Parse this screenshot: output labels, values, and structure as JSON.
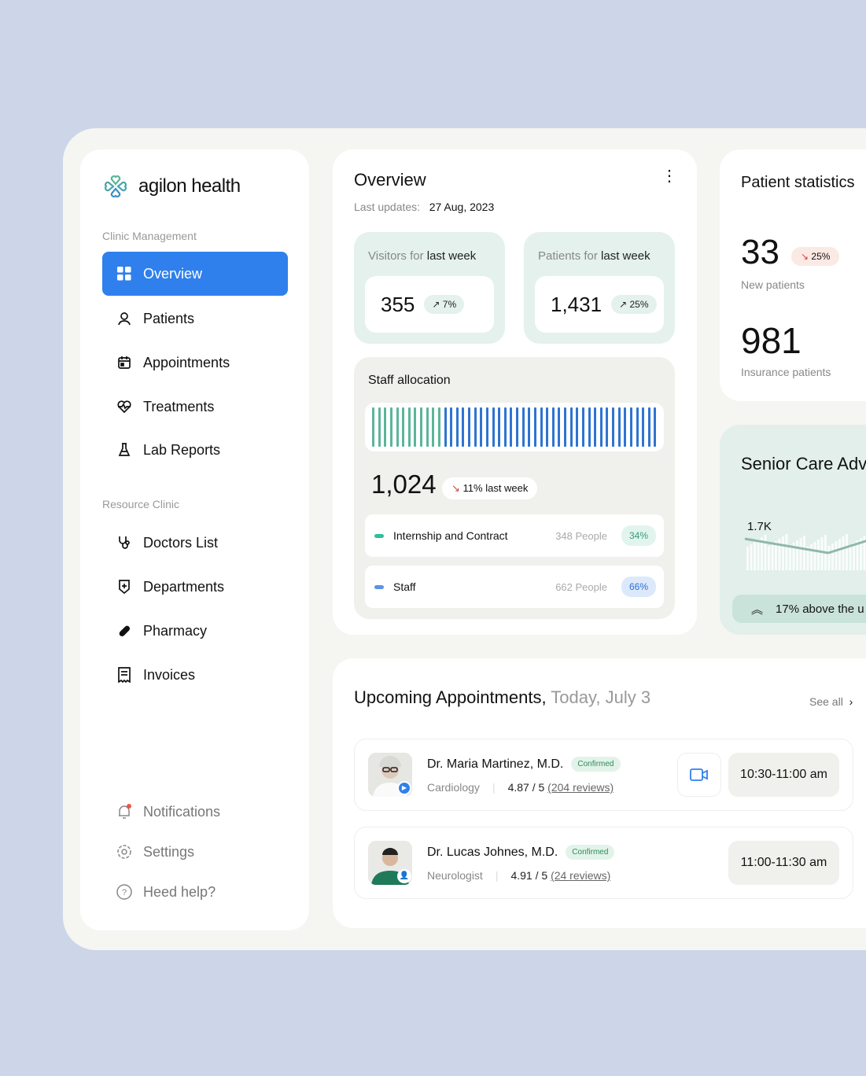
{
  "brand": {
    "name": "agilon health"
  },
  "sidebar": {
    "section1": "Clinic Management",
    "items": [
      {
        "label": "Overview",
        "icon": "grid-icon"
      },
      {
        "label": "Patients",
        "icon": "user-icon"
      },
      {
        "label": "Appointments",
        "icon": "calendar-icon"
      },
      {
        "label": "Treatments",
        "icon": "heart-pulse-icon"
      },
      {
        "label": "Lab Reports",
        "icon": "flask-icon"
      }
    ],
    "section2": "Resource Clinic",
    "items2": [
      {
        "label": "Doctors List",
        "icon": "stethoscope-icon"
      },
      {
        "label": "Departments",
        "icon": "shield-plus-icon"
      },
      {
        "label": "Pharmacy",
        "icon": "pill-icon"
      },
      {
        "label": "Invoices",
        "icon": "receipt-icon"
      }
    ],
    "bottom": [
      {
        "label": "Notifications",
        "icon": "bell-icon"
      },
      {
        "label": "Settings",
        "icon": "gear-icon"
      },
      {
        "label": "Heed help?",
        "icon": "help-icon"
      }
    ]
  },
  "overview": {
    "title": "Overview",
    "updates_label": "Last updates:",
    "updates_date": "27 Aug, 2023",
    "visitors": {
      "label_pre": "Visitors for",
      "label_bold": "last week",
      "value": "355",
      "change": "7%"
    },
    "patients": {
      "label_pre": "Patients for",
      "label_bold": "last week",
      "value": "1,431",
      "change": "25%"
    },
    "staff": {
      "title": "Staff allocation",
      "total": "1,024",
      "change": "11% last week",
      "rows": [
        {
          "label": "Internship and Contract",
          "people": "348 People",
          "pct": "34%"
        },
        {
          "label": "Staff",
          "people": "662 People",
          "pct": "66%"
        }
      ],
      "share_internship": 0.34,
      "colors": {
        "internship": "#5bb59a",
        "staff": "#2f74d0"
      }
    }
  },
  "patient_stats": {
    "title": "Patient statistics",
    "new_value": "33",
    "new_change": "25%",
    "new_label": "New patients",
    "ins_value": "981",
    "ins_label": "Insurance patients"
  },
  "senior": {
    "title": "Senior Care Adv",
    "peak": "1.7K",
    "note": "17% above the u"
  },
  "appointments": {
    "title": "Upcoming Appointments,",
    "date": "Today, July 3",
    "see_all": "See all",
    "items": [
      {
        "name": "Dr. Maria Martinez, M.D.",
        "status": "Confirmed",
        "dept": "Cardiology",
        "rating": "4.87 / 5",
        "reviews": "(204 reviews)",
        "time": "10:30-11:00 am",
        "video": true
      },
      {
        "name": "Dr. Lucas Johnes, M.D.",
        "status": "Confirmed",
        "dept": "Neurologist",
        "rating": "4.91 / 5",
        "reviews": "(24 reviews)",
        "time": "11:00-11:30 am",
        "video": false
      }
    ]
  },
  "colors": {
    "accent": "#2f80ed",
    "mint": "#e4f1ed",
    "background": "#cdd5e8"
  }
}
